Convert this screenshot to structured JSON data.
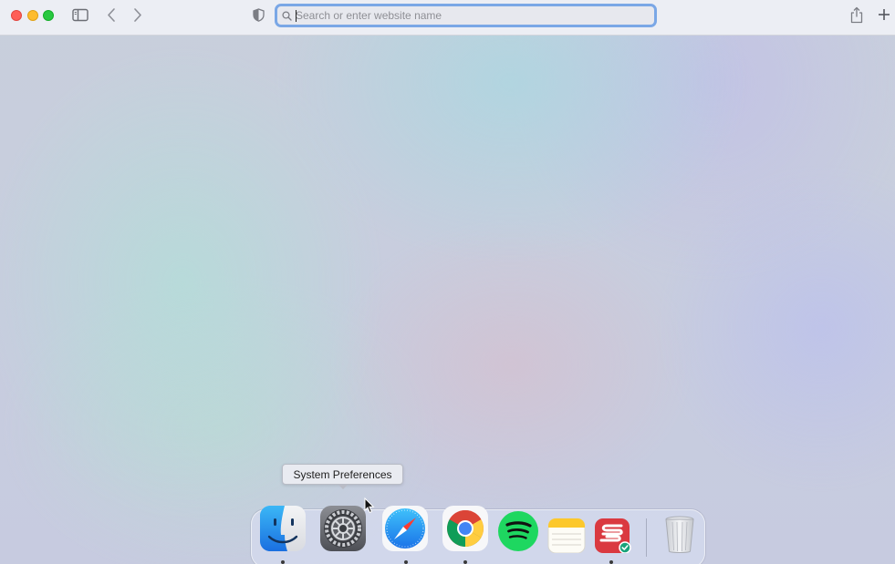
{
  "window": {
    "traffic_lights": [
      {
        "name": "close",
        "color": "#fe5f57"
      },
      {
        "name": "minimize",
        "color": "#febc2e"
      },
      {
        "name": "zoom",
        "color": "#28c840"
      }
    ],
    "toolbar_icons": [
      "sidebar-icon",
      "back-chevron-icon",
      "forward-chevron-icon",
      "privacy-shield-icon",
      "share-icon",
      "plus-icon"
    ]
  },
  "addressbar": {
    "placeholder": "Search or enter website name",
    "value": "",
    "focus_ring_color": "#7aa7e6"
  },
  "tooltip": {
    "text": "System Preferences"
  },
  "dock": {
    "apps": [
      {
        "name": "Finder",
        "icon": "finder-icon",
        "running": true
      },
      {
        "name": "System Preferences",
        "icon": "system-preferences-gear-icon",
        "running": false,
        "hovered": true
      },
      {
        "name": "Safari",
        "icon": "safari-compass-icon",
        "running": true
      },
      {
        "name": "Google Chrome",
        "icon": "chrome-icon",
        "running": true
      },
      {
        "name": "Spotify",
        "icon": "spotify-icon",
        "running": false
      },
      {
        "name": "Notes",
        "icon": "notes-icon",
        "running": false
      },
      {
        "name": "ExpressVPN",
        "icon": "expressvpn-icon",
        "running": true
      }
    ],
    "trash": {
      "name": "Trash",
      "icon": "trash-icon"
    }
  }
}
